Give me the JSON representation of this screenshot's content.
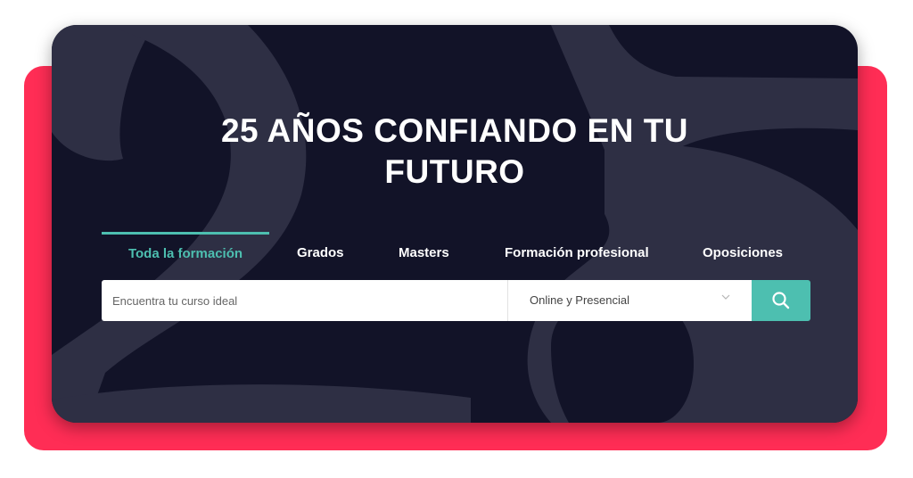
{
  "hero": {
    "title_line1": "25 AÑOS CONFIANDO EN TU",
    "title_line2": "FUTURO",
    "background_numeral": "25"
  },
  "tabs": [
    {
      "label": "Toda la formación",
      "active": true
    },
    {
      "label": "Grados",
      "active": false
    },
    {
      "label": "Masters",
      "active": false
    },
    {
      "label": "Formación profesional",
      "active": false
    },
    {
      "label": "Oposiciones",
      "active": false
    }
  ],
  "search": {
    "placeholder": "Encuentra tu curso ideal",
    "modality_selected": "Online y Presencial"
  },
  "colors": {
    "accent_red": "#ff2d55",
    "hero_bg": "#121328",
    "teal": "#4dbfb0",
    "numeral": "#2e2f44"
  },
  "icons": {
    "search_button": "search-icon",
    "select_arrow": "chevron-down-icon"
  }
}
